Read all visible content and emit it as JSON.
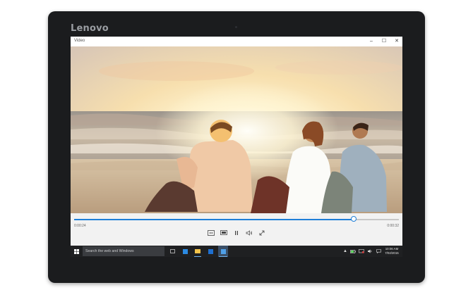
{
  "device": {
    "brand": "Lenovo"
  },
  "window": {
    "title": "Video",
    "buttons": {
      "minimize": "–",
      "maximize": "☐",
      "close": "✕"
    }
  },
  "player": {
    "elapsed": "0:00:24",
    "remaining": "0:00:32",
    "progress": 0.86,
    "controls": [
      "fit-screen-icon",
      "cast-icon",
      "pause-icon",
      "volume-icon",
      "fullscreen-icon"
    ]
  },
  "taskbar": {
    "search_placeholder": "Search the web and Windows",
    "pinned": [
      "task-view-icon",
      "edge-icon",
      "file-explorer-icon",
      "store-icon",
      "movies-tv-icon"
    ],
    "clock": {
      "time": "10:06 AM",
      "date": "7/02/2015"
    },
    "accent": "#6fb3f0"
  },
  "colors": {
    "seek_accent": "#1e7fd8",
    "bezel": "#1b1c1e"
  }
}
